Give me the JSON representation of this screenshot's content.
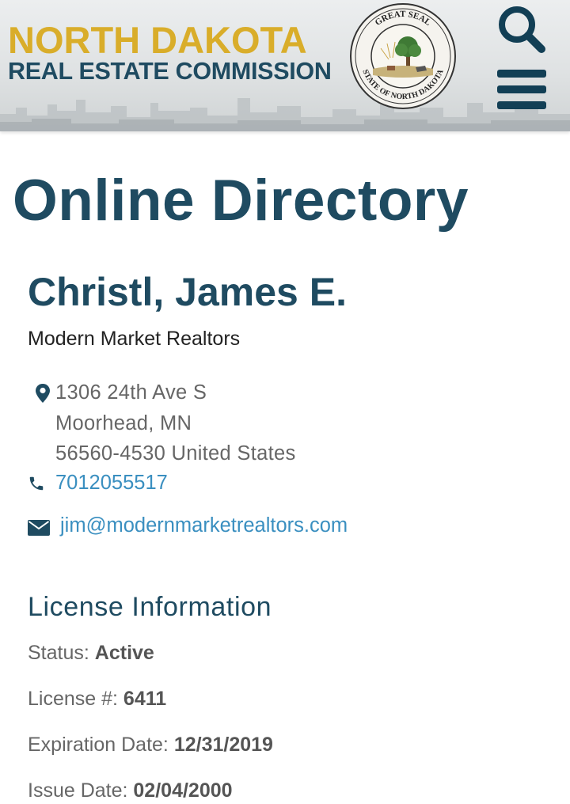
{
  "header": {
    "brand_line1": "NORTH DAKOTA",
    "brand_line2": "REAL ESTATE COMMISSION",
    "seal_top_text": "GREAT SEAL",
    "seal_bottom_text": "STATE OF NORTH DAKOTA",
    "search_icon": "search-icon",
    "menu_icon": "hamburger-menu-icon"
  },
  "main": {
    "page_title": "Online Directory",
    "person": {
      "name": "Christl, James E.",
      "company": "Modern Market Realtors",
      "address_line1": "1306 24th Ave S",
      "address_line2": "Moorhead, MN",
      "address_line3": "56560-4530 United States",
      "phone": "7012055517",
      "email": "jim@modernmarketrealtors.com"
    },
    "license": {
      "section_title": "License Information",
      "status_label": "Status:",
      "status_value": "Active",
      "number_label": "License #:",
      "number_value": "6411",
      "expiration_label": "Expiration Date:",
      "expiration_value": "12/31/2019",
      "issue_label": "Issue Date:",
      "issue_value": "02/04/2000"
    }
  },
  "colors": {
    "brand_gold": "#d9ad2a",
    "brand_navy": "#1f4b61",
    "link_blue": "#3a8fc0",
    "icon_dark": "#123f55"
  }
}
